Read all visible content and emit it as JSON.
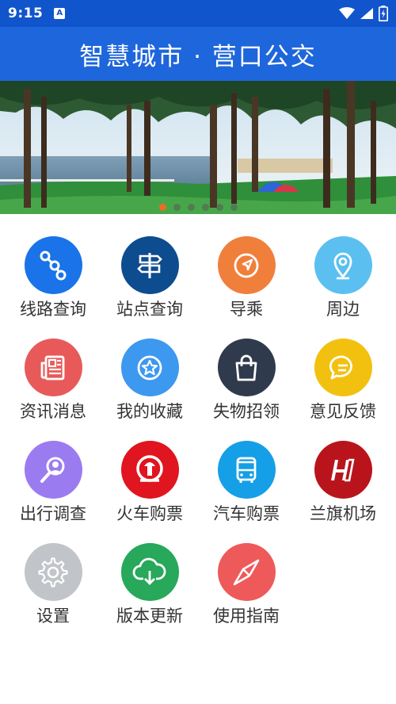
{
  "status": {
    "time": "9:15"
  },
  "header": {
    "title": "智慧城市 · 营口公交"
  },
  "banner": {
    "active_index": 0,
    "slide_count": 6
  },
  "menu": [
    {
      "label": "线路查询",
      "color": "#1a73e8",
      "icon": "route-icon"
    },
    {
      "label": "站点查询",
      "color": "#0d4c8f",
      "icon": "signpost-icon"
    },
    {
      "label": "导乘",
      "color": "#f07f3c",
      "icon": "navigation-arrow-icon"
    },
    {
      "label": "周边",
      "color": "#5bc0f0",
      "icon": "location-pin-icon"
    },
    {
      "label": "资讯消息",
      "color": "#e85a5a",
      "icon": "newspaper-icon"
    },
    {
      "label": "我的收藏",
      "color": "#3d98f0",
      "icon": "star-icon"
    },
    {
      "label": "失物招领",
      "color": "#2f3b4c",
      "icon": "shopping-bag-icon"
    },
    {
      "label": "意见反馈",
      "color": "#f2c110",
      "icon": "chat-bubble-icon"
    },
    {
      "label": "出行调查",
      "color": "#9b7bf0",
      "icon": "search-person-icon"
    },
    {
      "label": "火车购票",
      "color": "#e0151f",
      "icon": "railway-logo-icon"
    },
    {
      "label": "汽车购票",
      "color": "#159fe6",
      "icon": "bus-icon"
    },
    {
      "label": "兰旗机场",
      "color": "#b9141c",
      "icon": "airport-logo-icon"
    },
    {
      "label": "设置",
      "color": "#c1c4c8",
      "icon": "gear-icon"
    },
    {
      "label": "版本更新",
      "color": "#27a85a",
      "icon": "cloud-download-icon"
    },
    {
      "label": "使用指南",
      "color": "#ee5a5a",
      "icon": "compass-icon"
    }
  ]
}
